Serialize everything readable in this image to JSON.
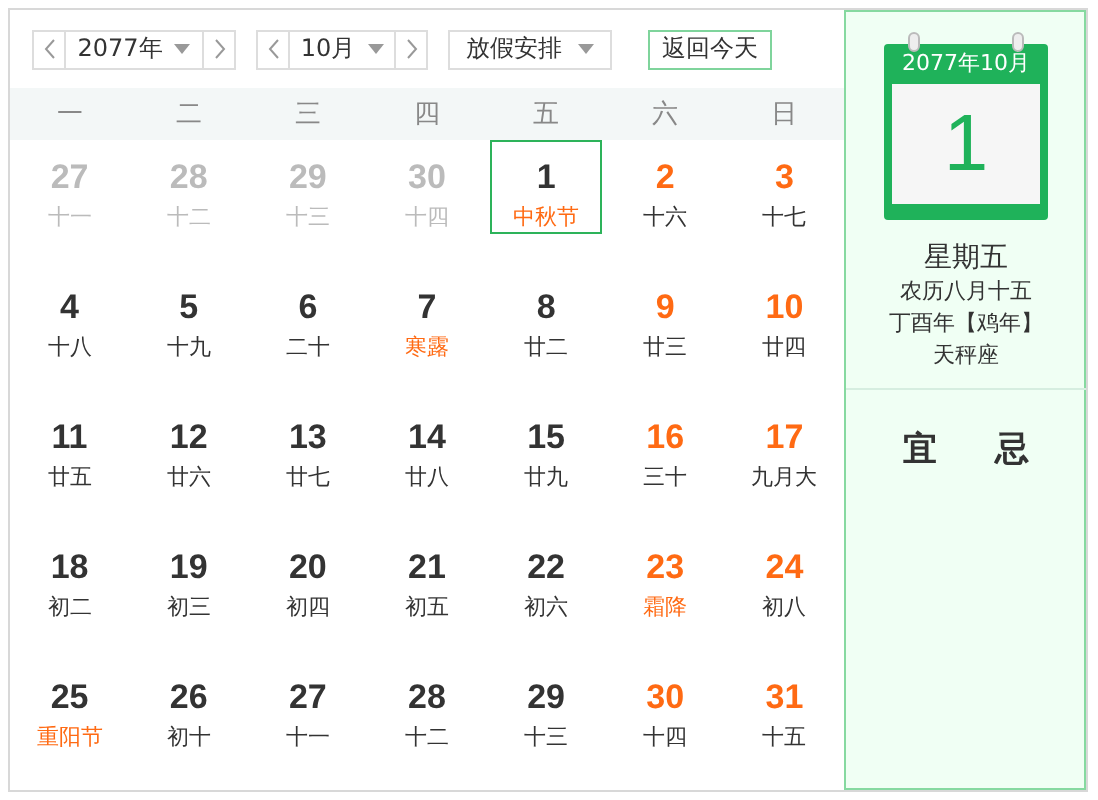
{
  "toolbar": {
    "year": "2077年",
    "month": "10月",
    "holiday": "放假安排",
    "today_button": "返回今天"
  },
  "weekdays": [
    "一",
    "二",
    "三",
    "四",
    "五",
    "六",
    "日"
  ],
  "days": [
    {
      "day": "27",
      "lunar": "十一",
      "other_month": true,
      "selected": false
    },
    {
      "day": "28",
      "lunar": "十二",
      "other_month": true,
      "selected": false
    },
    {
      "day": "29",
      "lunar": "十三",
      "other_month": true,
      "selected": false
    },
    {
      "day": "30",
      "lunar": "十四",
      "other_month": true,
      "selected": false
    },
    {
      "day": "1",
      "lunar": "中秋节",
      "other_month": false,
      "weekend": false,
      "festival": true,
      "selected": true
    },
    {
      "day": "2",
      "lunar": "十六",
      "other_month": false,
      "weekend": true,
      "festival": false,
      "selected": false
    },
    {
      "day": "3",
      "lunar": "十七",
      "other_month": false,
      "weekend": true,
      "festival": false,
      "selected": false
    },
    {
      "day": "4",
      "lunar": "十八",
      "other_month": false,
      "weekend": false,
      "festival": false,
      "selected": false
    },
    {
      "day": "5",
      "lunar": "十九",
      "other_month": false,
      "weekend": false,
      "festival": false,
      "selected": false
    },
    {
      "day": "6",
      "lunar": "二十",
      "other_month": false,
      "weekend": false,
      "festival": false,
      "selected": false
    },
    {
      "day": "7",
      "lunar": "寒露",
      "other_month": false,
      "weekend": false,
      "festival": true,
      "selected": false
    },
    {
      "day": "8",
      "lunar": "廿二",
      "other_month": false,
      "weekend": false,
      "festival": false,
      "selected": false
    },
    {
      "day": "9",
      "lunar": "廿三",
      "other_month": false,
      "weekend": true,
      "festival": false,
      "selected": false
    },
    {
      "day": "10",
      "lunar": "廿四",
      "other_month": false,
      "weekend": true,
      "festival": false,
      "selected": false
    },
    {
      "day": "11",
      "lunar": "廿五",
      "other_month": false,
      "weekend": false,
      "festival": false,
      "selected": false
    },
    {
      "day": "12",
      "lunar": "廿六",
      "other_month": false,
      "weekend": false,
      "festival": false,
      "selected": false
    },
    {
      "day": "13",
      "lunar": "廿七",
      "other_month": false,
      "weekend": false,
      "festival": false,
      "selected": false
    },
    {
      "day": "14",
      "lunar": "廿八",
      "other_month": false,
      "weekend": false,
      "festival": false,
      "selected": false
    },
    {
      "day": "15",
      "lunar": "廿九",
      "other_month": false,
      "weekend": false,
      "festival": false,
      "selected": false
    },
    {
      "day": "16",
      "lunar": "三十",
      "other_month": false,
      "weekend": true,
      "festival": false,
      "selected": false
    },
    {
      "day": "17",
      "lunar": "九月大",
      "other_month": false,
      "weekend": true,
      "festival": false,
      "selected": false
    },
    {
      "day": "18",
      "lunar": "初二",
      "other_month": false,
      "weekend": false,
      "festival": false,
      "selected": false
    },
    {
      "day": "19",
      "lunar": "初三",
      "other_month": false,
      "weekend": false,
      "festival": false,
      "selected": false
    },
    {
      "day": "20",
      "lunar": "初四",
      "other_month": false,
      "weekend": false,
      "festival": false,
      "selected": false
    },
    {
      "day": "21",
      "lunar": "初五",
      "other_month": false,
      "weekend": false,
      "festival": false,
      "selected": false
    },
    {
      "day": "22",
      "lunar": "初六",
      "other_month": false,
      "weekend": false,
      "festival": false,
      "selected": false
    },
    {
      "day": "23",
      "lunar": "霜降",
      "other_month": false,
      "weekend": true,
      "festival": true,
      "selected": false
    },
    {
      "day": "24",
      "lunar": "初八",
      "other_month": false,
      "weekend": true,
      "festival": false,
      "selected": false
    },
    {
      "day": "25",
      "lunar": "重阳节",
      "other_month": false,
      "weekend": false,
      "festival": true,
      "selected": false
    },
    {
      "day": "26",
      "lunar": "初十",
      "other_month": false,
      "weekend": false,
      "festival": false,
      "selected": false
    },
    {
      "day": "27",
      "lunar": "十一",
      "other_month": false,
      "weekend": false,
      "festival": false,
      "selected": false
    },
    {
      "day": "28",
      "lunar": "十二",
      "other_month": false,
      "weekend": false,
      "festival": false,
      "selected": false
    },
    {
      "day": "29",
      "lunar": "十三",
      "other_month": false,
      "weekend": false,
      "festival": false,
      "selected": false
    },
    {
      "day": "30",
      "lunar": "十四",
      "other_month": false,
      "weekend": true,
      "festival": false,
      "selected": false
    },
    {
      "day": "31",
      "lunar": "十五",
      "other_month": false,
      "weekend": true,
      "festival": false,
      "selected": false
    }
  ],
  "detail": {
    "page_header": "2077年10月",
    "page_day": "1",
    "weekday": "星期五",
    "lunar_date": "农历八月十五",
    "ganzhi": "丁酉年【鸡年】",
    "zodiac": "天秤座",
    "good": "宜",
    "bad": "忌"
  }
}
